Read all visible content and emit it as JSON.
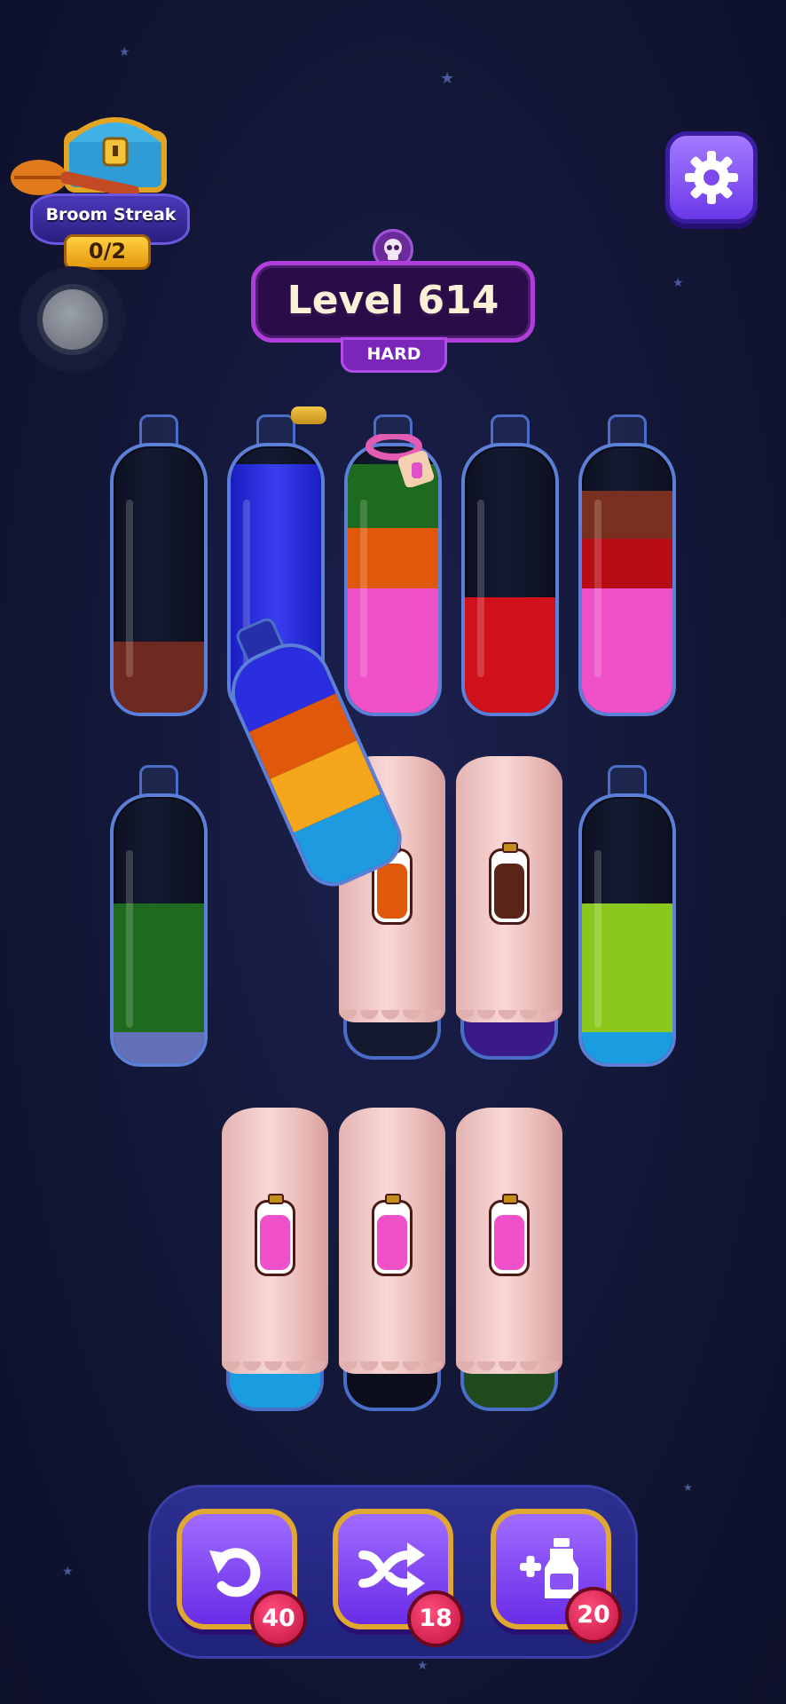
{
  "streak": {
    "title": "Broom Streak",
    "count": "0/2"
  },
  "level": {
    "label": "Level 614",
    "difficulty": "HARD"
  },
  "actions": [
    {
      "name": "undo",
      "count": "40"
    },
    {
      "name": "shuffle",
      "count": "18"
    },
    {
      "name": "add-bottle",
      "count": "20"
    }
  ],
  "colors": {
    "brown": "#6e2a20",
    "blue": "#2a2ee0",
    "green": "#1e6a1e",
    "orange": "#e0580a",
    "pink": "#f050c8",
    "red": "#d0101a",
    "darkbrown": "#7a3020",
    "crimson": "#b80c14",
    "lavender": "#6470b8",
    "lime": "#8ac81e",
    "cyan": "#1a9ce0",
    "yellow": "#f6a61a",
    "sky": "#1e9ae0"
  }
}
